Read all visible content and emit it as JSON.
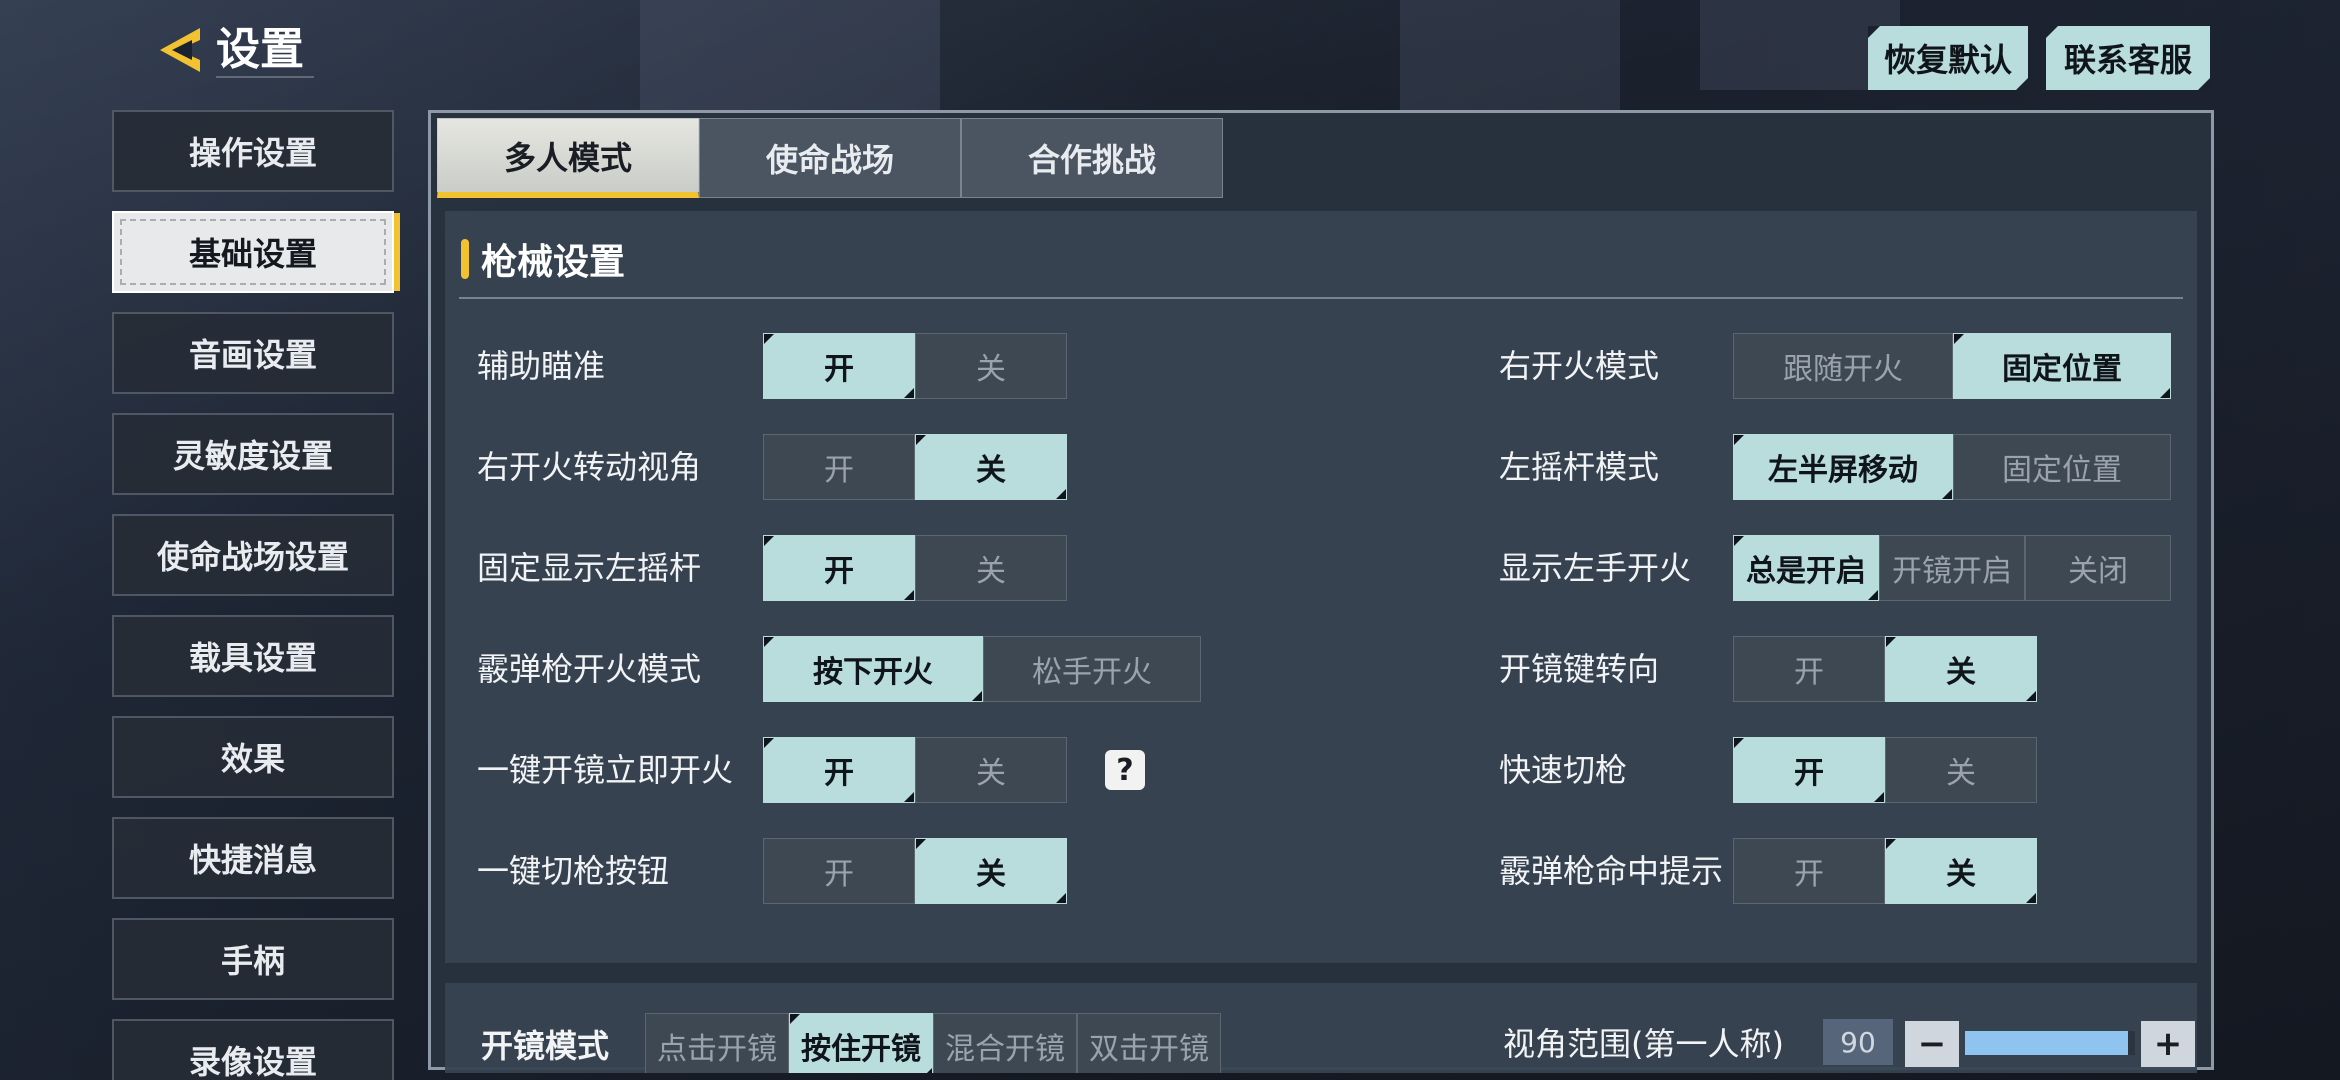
{
  "header": {
    "title": "设置",
    "restore_default": "恢复默认",
    "contact_support": "联系客服",
    "accent": "#f2c230"
  },
  "sidebar": {
    "items": [
      {
        "label": "操作设置",
        "active": false
      },
      {
        "label": "基础设置",
        "active": true
      },
      {
        "label": "音画设置",
        "active": false
      },
      {
        "label": "灵敏度设置",
        "active": false
      },
      {
        "label": "使命战场设置",
        "active": false
      },
      {
        "label": "载具设置",
        "active": false
      },
      {
        "label": "效果",
        "active": false
      },
      {
        "label": "快捷消息",
        "active": false
      },
      {
        "label": "手柄",
        "active": false
      },
      {
        "label": "录像设置",
        "active": false
      }
    ]
  },
  "tabs": [
    {
      "label": "多人模式",
      "active": true
    },
    {
      "label": "使命战场",
      "active": false
    },
    {
      "label": "合作挑战",
      "active": false
    }
  ],
  "section": {
    "title": "枪械设置",
    "left": [
      {
        "label": "辅助瞄准",
        "options": [
          "开",
          "关"
        ],
        "selected": 0
      },
      {
        "label": "右开火转动视角",
        "options": [
          "开",
          "关"
        ],
        "selected": 1
      },
      {
        "label": "固定显示左摇杆",
        "options": [
          "开",
          "关"
        ],
        "selected": 0
      },
      {
        "label": "霰弹枪开火模式",
        "options": [
          "按下开火",
          "松手开火"
        ],
        "selected": 0
      },
      {
        "label": "一键开镜立即开火",
        "options": [
          "开",
          "关"
        ],
        "selected": 0,
        "help": "?"
      },
      {
        "label": "一键切枪按钮",
        "options": [
          "开",
          "关"
        ],
        "selected": 1
      }
    ],
    "right": [
      {
        "label": "右开火模式",
        "options": [
          "跟随开火",
          "固定位置"
        ],
        "selected": 1
      },
      {
        "label": "左摇杆模式",
        "options": [
          "左半屏移动",
          "固定位置"
        ],
        "selected": 0
      },
      {
        "label": "显示左手开火",
        "options": [
          "总是开启",
          "开镜开启",
          "关闭"
        ],
        "selected": 0
      },
      {
        "label": "开镜键转向",
        "options": [
          "开",
          "关"
        ],
        "selected": 1
      },
      {
        "label": "快速切枪",
        "options": [
          "开",
          "关"
        ],
        "selected": 0
      },
      {
        "label": "霰弹枪命中提示",
        "options": [
          "开",
          "关"
        ],
        "selected": 1
      }
    ]
  },
  "section2": {
    "scope_label": "开镜模式",
    "scope_options": [
      "点击开镜",
      "按住开镜",
      "混合开镜",
      "双击开镜"
    ],
    "scope_selected": 1,
    "fov_label": "视角范围(第一人称)",
    "fov_value": "90",
    "minus": "−",
    "plus": "+",
    "fov_fill": 0.96
  }
}
